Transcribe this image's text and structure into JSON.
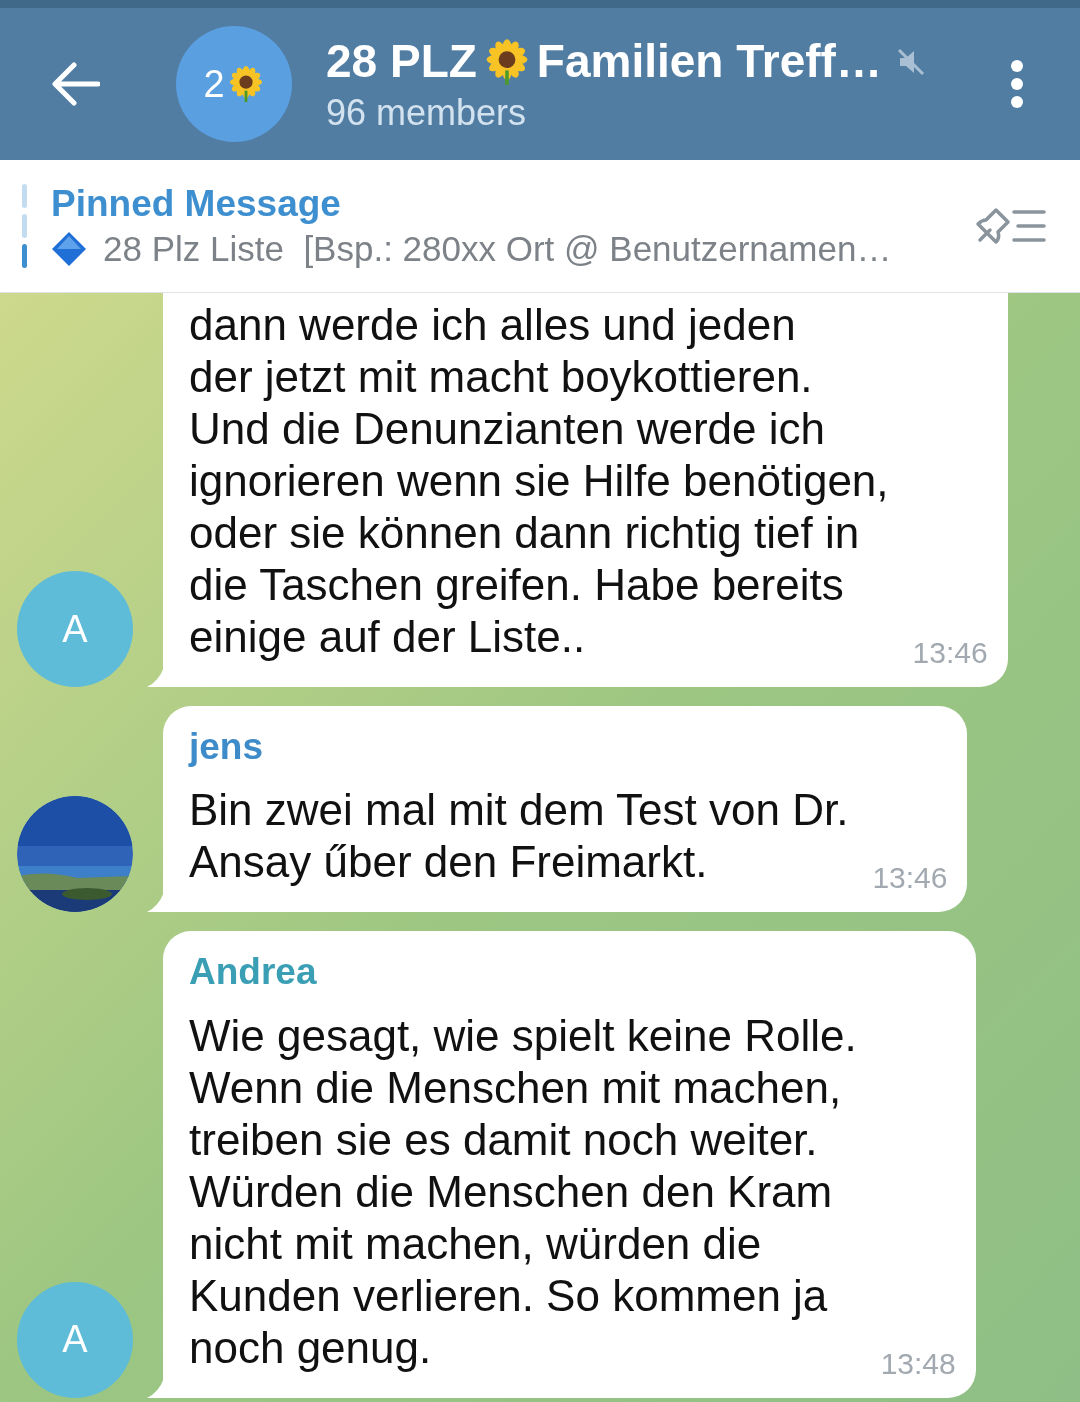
{
  "header": {
    "avatar_text": "2",
    "title_parts": [
      "28 PLZ",
      "Familien Treff…"
    ],
    "muted": true,
    "subtitle": "96 members"
  },
  "pinned": {
    "label": "Pinned Message",
    "text": "28 Plz Liste  [Bsp.: 280xx Ort @ Benutzernamen…"
  },
  "messages": [
    {
      "avatar": {
        "kind": "letter",
        "text": "A"
      },
      "lines": [
        "dann werde ich alles und jeden",
        "der jetzt mit macht boykottieren.",
        "Und die Denunzianten werde ich",
        "ignorieren wenn sie Hilfe benötigen,",
        "oder sie können dann richtig tief in",
        "die Taschen greifen. Habe bereits",
        "einige auf der Liste.."
      ],
      "time": "13:46"
    },
    {
      "avatar": {
        "kind": "picture"
      },
      "sender": "jens",
      "color": "#3d8bc9",
      "lines": [
        "Bin zwei mal mit dem Test von Dr.",
        "Ansay űber den Freimarkt."
      ],
      "time": "13:46"
    },
    {
      "avatar": {
        "kind": "letter",
        "text": "A"
      },
      "sender": "Andrea",
      "color": "#3a9fb5",
      "lines": [
        "Wie gesagt, wie spielt keine Rolle.",
        "Wenn die Menschen mit machen,",
        "treiben sie es damit noch weiter.",
        "Würden die Menschen den Kram",
        "nicht mit machen, würden die",
        "Kunden verlieren. So kommen ja",
        "noch genug."
      ],
      "time": "13:48"
    }
  ]
}
